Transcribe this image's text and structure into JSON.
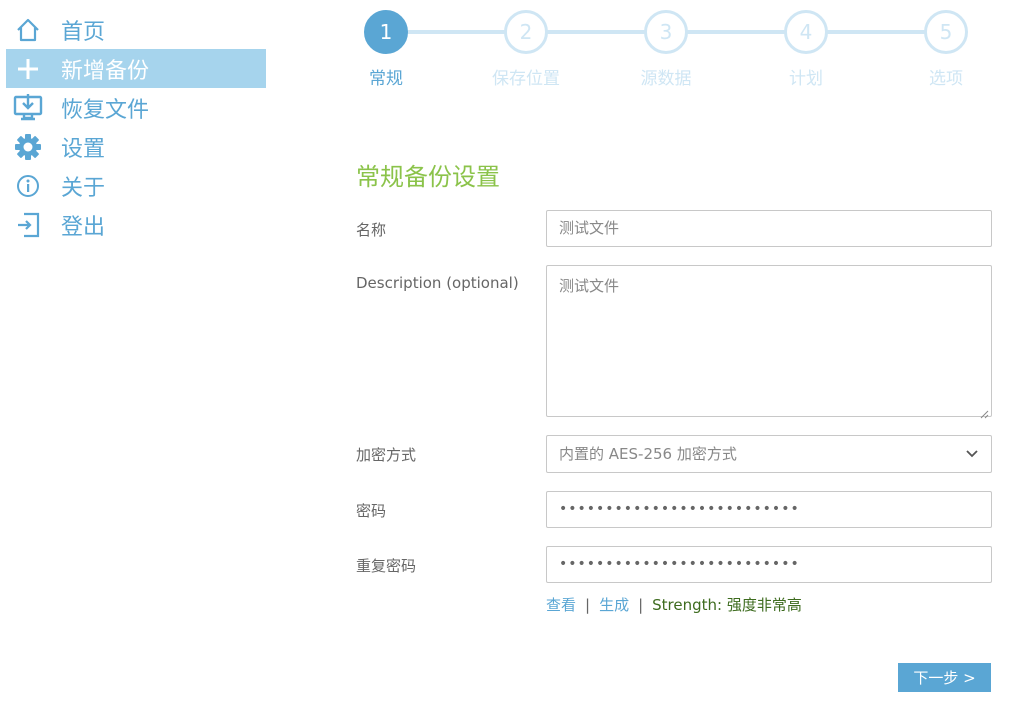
{
  "sidebar": {
    "items": [
      {
        "label": "首页",
        "icon": "home-icon",
        "active": false
      },
      {
        "label": "新增备份",
        "icon": "plus-icon",
        "active": true
      },
      {
        "label": "恢复文件",
        "icon": "restore-icon",
        "active": false
      },
      {
        "label": "设置",
        "icon": "gear-icon",
        "active": false
      },
      {
        "label": "关于",
        "icon": "info-icon",
        "active": false
      },
      {
        "label": "登出",
        "icon": "logout-icon",
        "active": false
      }
    ]
  },
  "stepper": {
    "steps": [
      {
        "number": "1",
        "label": "常规",
        "active": true
      },
      {
        "number": "2",
        "label": "保存位置",
        "active": false
      },
      {
        "number": "3",
        "label": "源数据",
        "active": false
      },
      {
        "number": "4",
        "label": "计划",
        "active": false
      },
      {
        "number": "5",
        "label": "选项",
        "active": false
      }
    ]
  },
  "form": {
    "title": "常规备份设置",
    "name": {
      "label": "名称",
      "value": "测试文件"
    },
    "description": {
      "label": "Description (optional)",
      "value": "测试文件"
    },
    "encryption": {
      "label": "加密方式",
      "value": "内置的 AES-256 加密方式"
    },
    "password": {
      "label": "密码",
      "value": "••••••••••••••••••••••••••"
    },
    "repeat_password": {
      "label": "重复密码",
      "value": "••••••••••••••••••••••••••"
    },
    "links": {
      "view": "查看",
      "separator": "|",
      "generate": "生成",
      "strength": "Strength: 强度非常高"
    },
    "next_button": "下一步 >"
  },
  "colors": {
    "accent": "#5aa6d4",
    "active_nav_bg": "#a6d4ed",
    "inactive_step": "#cfe6f4",
    "title_green": "#8bc34a",
    "strength_green": "#3d6b1e"
  }
}
